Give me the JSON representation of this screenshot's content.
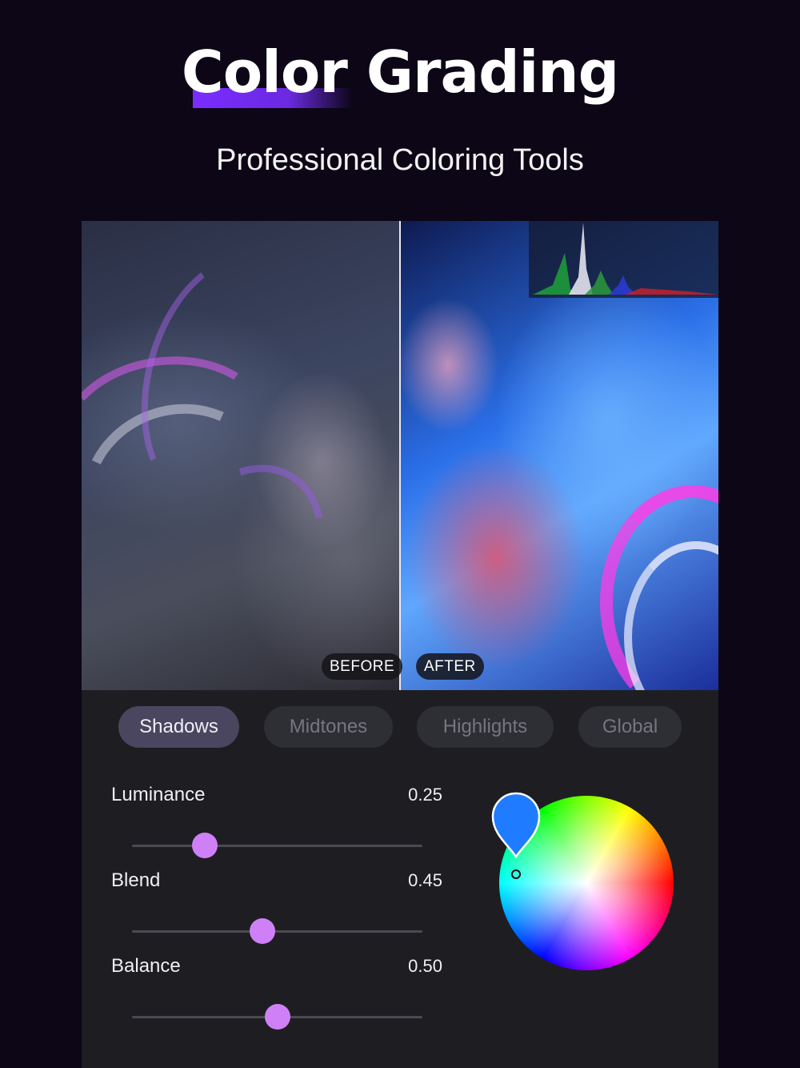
{
  "header": {
    "title": "Color Grading",
    "subtitle": "Professional Coloring Tools",
    "accent_color": "#7a2cff"
  },
  "compare": {
    "before_label": "BEFORE",
    "after_label": "AFTER"
  },
  "tabs": [
    {
      "label": "Shadows",
      "active": true
    },
    {
      "label": "Midtones",
      "active": false
    },
    {
      "label": "Highlights",
      "active": false
    },
    {
      "label": "Global",
      "active": false
    }
  ],
  "sliders": [
    {
      "label": "Luminance",
      "value": "0.25",
      "level": 0.25
    },
    {
      "label": "Blend",
      "value": "0.45",
      "level": 0.45
    },
    {
      "label": "Balance",
      "value": "0.50",
      "level": 0.5
    }
  ],
  "color_wheel": {
    "selected_color": "#1f7bff",
    "icon": "color-picker-pin-icon"
  },
  "colors": {
    "background": "#0c0616",
    "panel": "#1e1e22",
    "slider_knob": "#d080f6",
    "tab_active": "#4a4660",
    "tab_inactive": "#2e2e35"
  }
}
